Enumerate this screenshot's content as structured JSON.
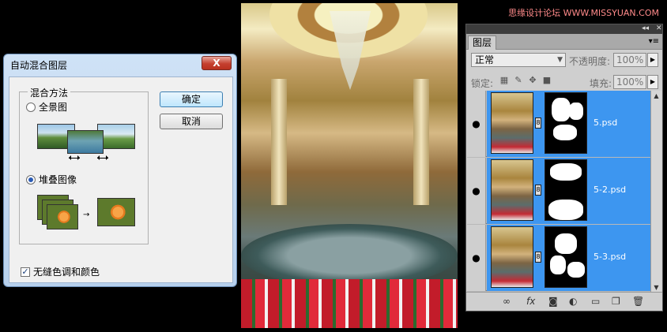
{
  "watermark": "思缘设计论坛 WWW.MISSYUAN.COM",
  "dialog": {
    "title": "自动混合图层",
    "close_glyph": "X",
    "group_label": "混合方法",
    "option_panorama": "全景图",
    "option_stack": "堆叠图像",
    "selected_option": "堆叠图像",
    "ok_label": "确定",
    "cancel_label": "取消",
    "checkbox_label": "无缝色调和颜色",
    "checkbox_checked": true
  },
  "layers_panel": {
    "tab_label": "图层",
    "blend_mode": "正常",
    "opacity_label": "不透明度:",
    "opacity_value": "100%",
    "lock_label": "锁定:",
    "fill_label": "填充:",
    "fill_value": "100%",
    "layers": [
      {
        "name": "5.psd",
        "visible": true,
        "selected": true
      },
      {
        "name": "5-2.psd",
        "visible": true,
        "selected": true
      },
      {
        "name": "5-3.psd",
        "visible": true,
        "selected": true
      }
    ],
    "selection_color": "#3d96f0",
    "footer_icons": [
      "link-icon",
      "fx-icon",
      "mask-icon",
      "adjustment-icon",
      "folder-icon",
      "new-layer-icon",
      "trash-icon"
    ]
  }
}
